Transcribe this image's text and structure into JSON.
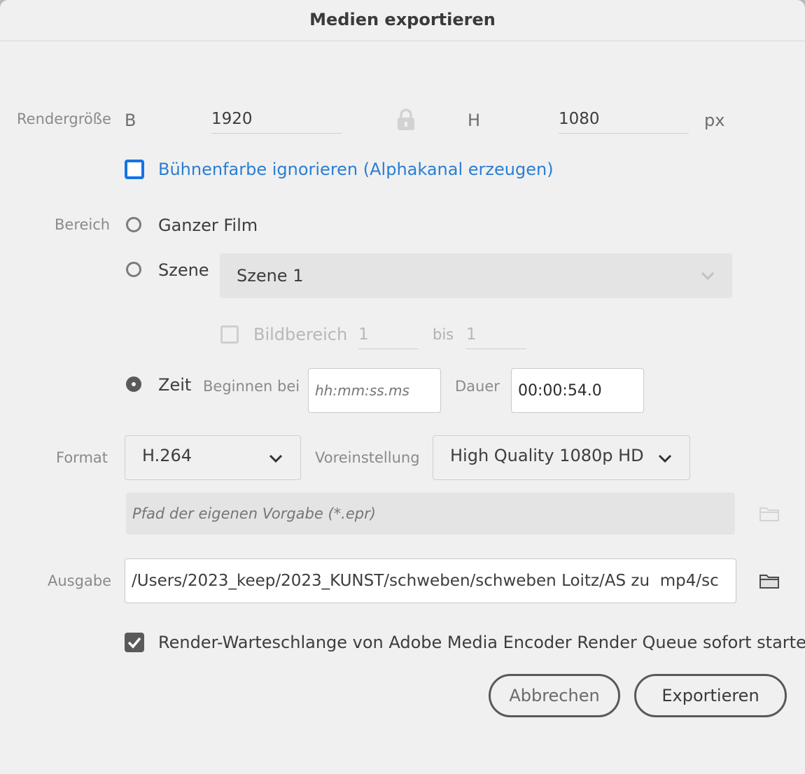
{
  "dialog": {
    "title": "Medien exportieren"
  },
  "render_size": {
    "label": "Rendergröße",
    "width_label": "B",
    "width_value": "1920",
    "height_label": "H",
    "height_value": "1080",
    "unit": "px",
    "lock_icon": "lock-icon"
  },
  "alpha": {
    "label": "Bühnenfarbe ignorieren (Alphakanal erzeugen)",
    "checked": false
  },
  "range": {
    "label": "Bereich",
    "whole_movie": "Ganzer Film",
    "scene": "Szene",
    "scene_select": "Szene 1",
    "frame_range_label": "Bildbereich",
    "frame_from": "1",
    "to_label": "bis",
    "frame_to": "1",
    "time": "Zeit",
    "start_label": "Beginnen bei",
    "start_placeholder": "hh:mm:ss.ms",
    "duration_label": "Dauer",
    "duration_value": "00:00:54.0",
    "selected": "time"
  },
  "format": {
    "label": "Format",
    "value": "H.264",
    "preset_label": "Voreinstellung",
    "preset_value": "High Quality 1080p HD",
    "custom_preset_placeholder": "Pfad der eigenen Vorgabe (*.epr)"
  },
  "output": {
    "label": "Ausgabe",
    "path": "/Users/2023_keep/2023_KUNST/schweben/schweben Loitz/AS zu  mp4/sc"
  },
  "queue": {
    "label": "Render-Warteschlange von Adobe Media Encoder Render Queue sofort starten",
    "checked": true
  },
  "buttons": {
    "cancel": "Abbrechen",
    "export": "Exportieren"
  },
  "colors": {
    "accent": "#1473e6",
    "link_text": "#2a7ed3",
    "background": "#f0f0f0"
  }
}
